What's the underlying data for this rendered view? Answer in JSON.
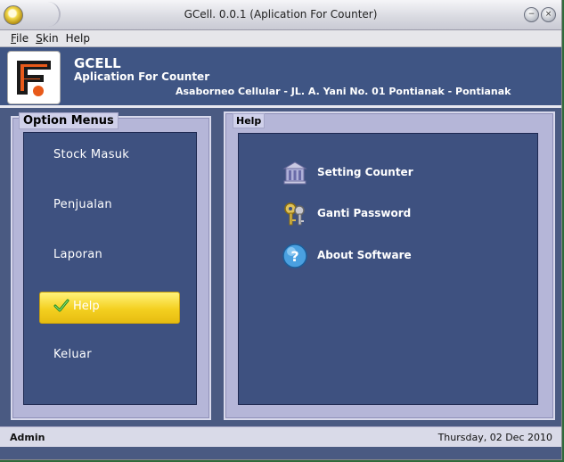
{
  "window": {
    "title": "GCell. 0.0.1 (Aplication For Counter)"
  },
  "menu": [
    "File",
    "Skin",
    "Help"
  ],
  "header": {
    "app_name": "GCELL",
    "app_subtitle": "Aplication For Counter",
    "address": "Asaborneo Cellular - JL. A. Yani No. 01 Pontianak - Pontianak"
  },
  "option_panel": {
    "title": "Option Menus",
    "items": [
      {
        "label": "Stock Masuk",
        "active": false
      },
      {
        "label": "Penjualan",
        "active": false
      },
      {
        "label": "Laporan",
        "active": false
      },
      {
        "label": "Help",
        "active": true
      },
      {
        "label": "Keluar",
        "active": false
      }
    ]
  },
  "help_panel": {
    "title": "Help",
    "items": [
      {
        "label": "Setting Counter",
        "icon": "building-icon"
      },
      {
        "label": "Ganti Password",
        "icon": "keys-icon"
      },
      {
        "label": "About Software",
        "icon": "question-icon"
      }
    ]
  },
  "status": {
    "user": "Admin",
    "date": "Thursday, 02 Dec 2010"
  },
  "colors": {
    "window_bg": "#4a5a82",
    "header_bg": "#3f5584",
    "panel_border": "#b5b6d8",
    "inner_bg": "#3e5180",
    "active_item": "#f4d020"
  }
}
